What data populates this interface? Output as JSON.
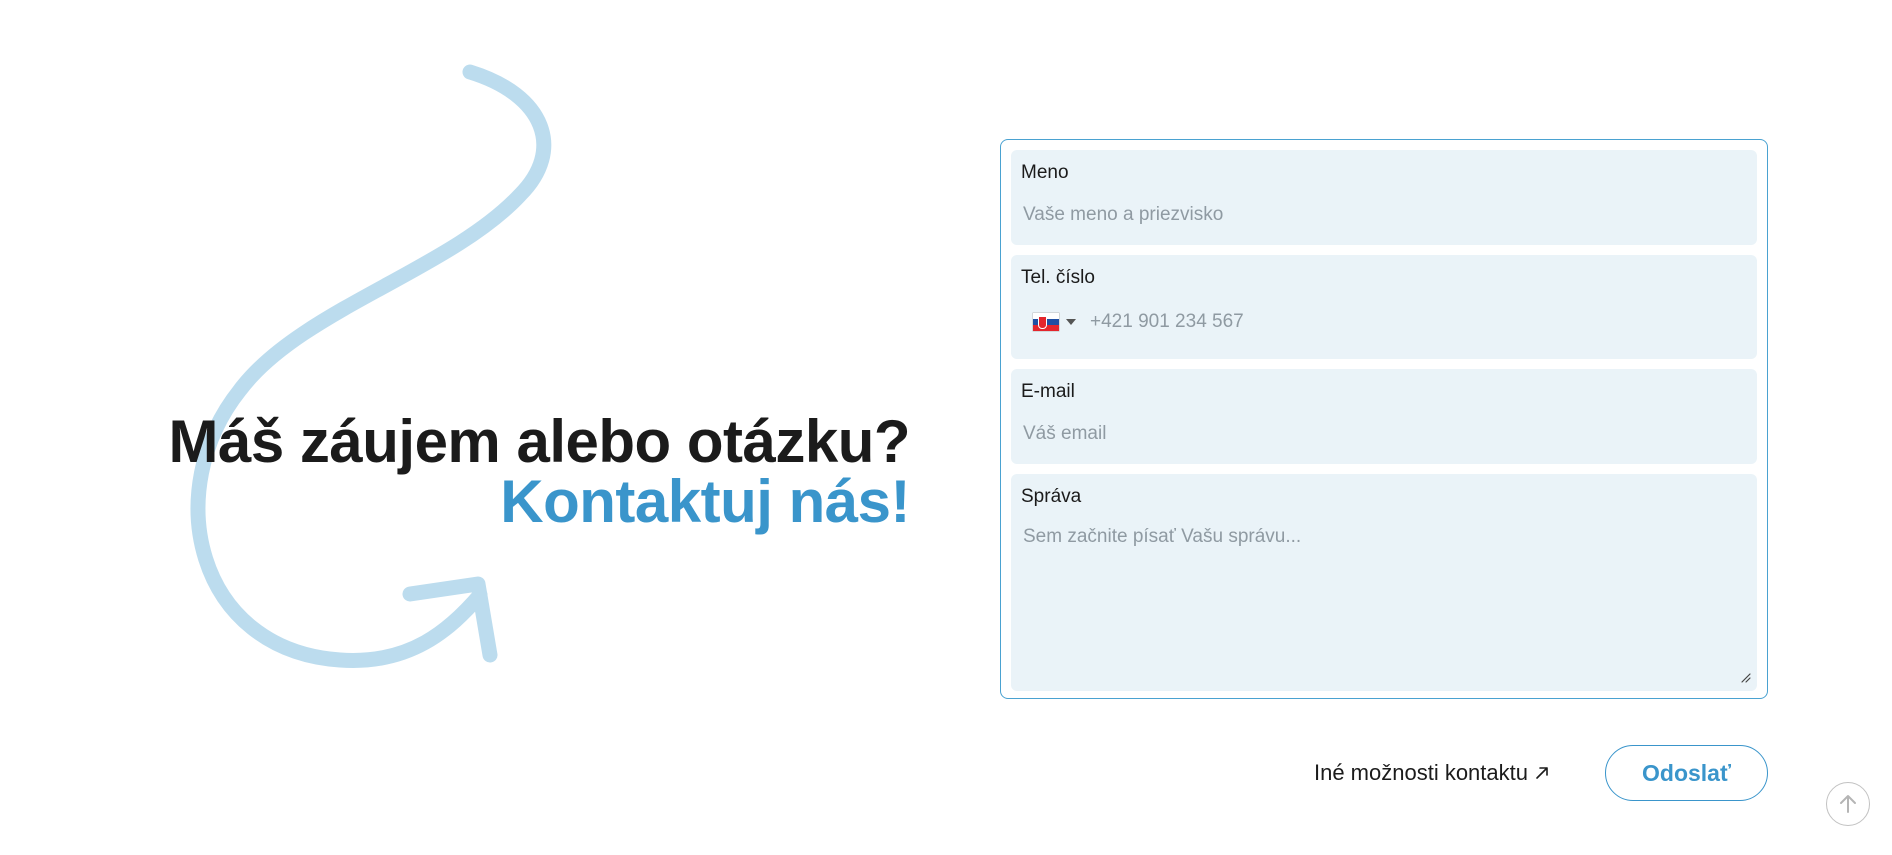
{
  "headline": {
    "question": "Máš záujem alebo otázku?",
    "cta": "Kontaktuj nás!"
  },
  "form": {
    "name": {
      "label": "Meno",
      "placeholder": "Vaše meno a priezvisko"
    },
    "phone": {
      "label": "Tel. číslo",
      "placeholder": "+421 901 234 567",
      "country_icon": "slovakia-flag-icon"
    },
    "email": {
      "label": "E-mail",
      "placeholder": "Váš email"
    },
    "message": {
      "label": "Správa",
      "placeholder": "Sem začnite písať Vašu správu..."
    }
  },
  "actions": {
    "other_contact_label": "Iné možnosti kontaktu",
    "submit_label": "Odoslať"
  },
  "colors": {
    "accent": "#3a95cb",
    "field_bg": "#eaf3f8",
    "swoosh": "#bcdcee",
    "text": "#1b1b1b"
  },
  "icons": {
    "other_contact": "arrow-up-right-icon",
    "scroll_top": "arrow-up-icon",
    "decoration": "curved-arrow-icon"
  }
}
